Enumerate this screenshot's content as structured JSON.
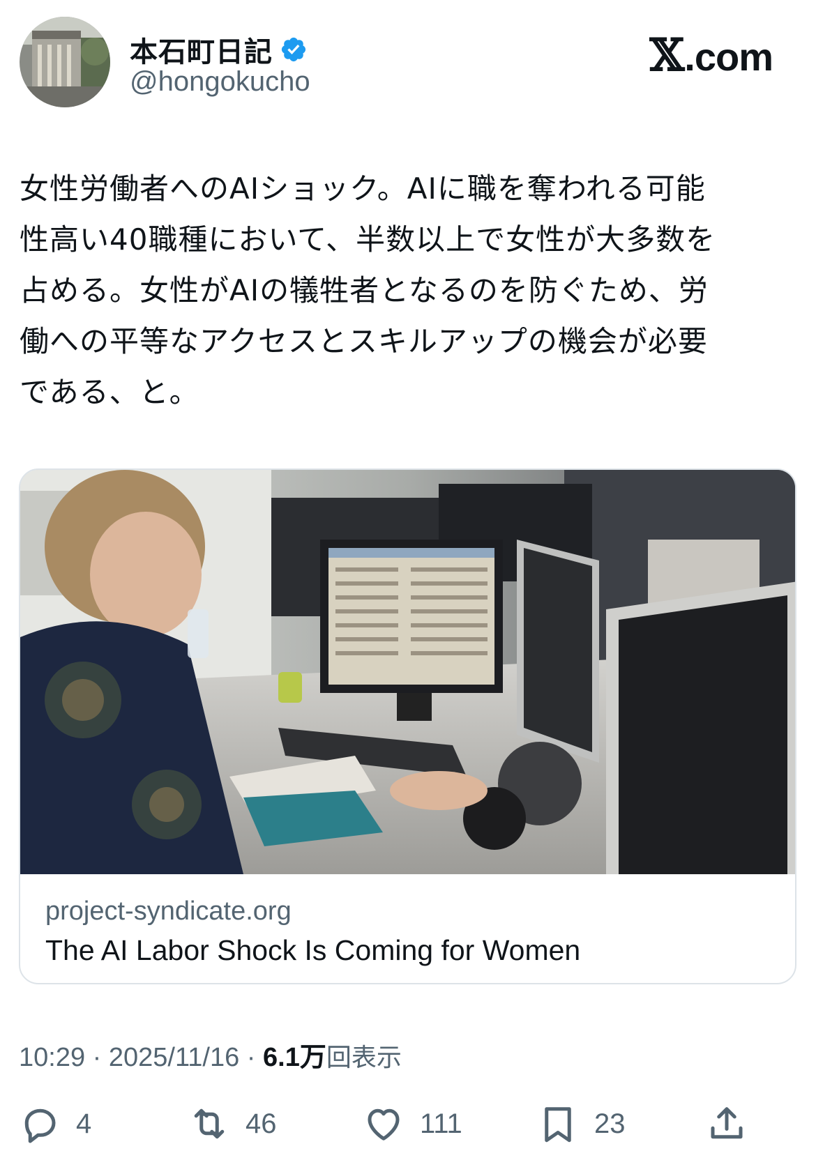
{
  "author": {
    "display_name": "本石町日記",
    "handle": "@hongokucho",
    "verified": true
  },
  "brand": {
    "x": "𝕏",
    "domain": ".com"
  },
  "tweet": {
    "text": "女性労働者へのAIショック。AIに職を奪われる可能\n性高い40職種において、半数以上で女性が大多数を\n占める。女性がAIの犠牲者となるのを防ぐため、労\n働への平等なアクセスとスキルアップの機会が必要\nである、と。"
  },
  "card": {
    "domain": "project-syndicate.org",
    "title": "The AI Labor Shock Is Coming for Women"
  },
  "meta": {
    "time": "10:29",
    "separator": " · ",
    "date": "2025/11/16",
    "views_count": "6.1万",
    "views_label": "回表示"
  },
  "actions": {
    "reply": {
      "icon": "reply-icon",
      "count": "4"
    },
    "retweet": {
      "icon": "retweet-icon",
      "count": "46"
    },
    "like": {
      "icon": "heart-icon",
      "count": "111"
    },
    "bookmark": {
      "icon": "bookmark-icon",
      "count": "23"
    },
    "share": {
      "icon": "share-icon"
    }
  },
  "colors": {
    "text": "#0f1419",
    "secondary": "#536471",
    "verified": "#1d9bf0",
    "border": "#dde3e8"
  }
}
